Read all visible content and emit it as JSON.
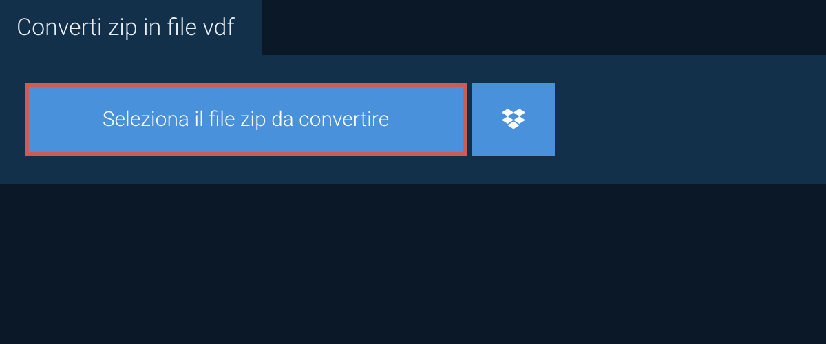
{
  "header": {
    "title": "Converti zip in file vdf"
  },
  "actions": {
    "select_file_label": "Seleziona il file zip da convertire"
  },
  "colors": {
    "bg_dark": "#0a1828",
    "panel": "#13304a",
    "button": "#4991db",
    "highlight_border": "#d05a56"
  }
}
